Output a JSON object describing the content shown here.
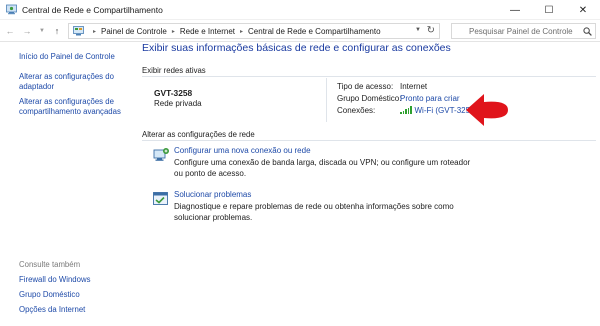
{
  "window": {
    "title": "Central de Rede e Compartilhamento",
    "controls": {
      "minimize": "—",
      "maximize": "☐",
      "close": "✕"
    }
  },
  "address_bar": {
    "breadcrumbs": [
      "Painel de Controle",
      "Rede e Internet",
      "Central de Rede e Compartilhamento"
    ],
    "search_placeholder": "Pesquisar Painel de Controle"
  },
  "sidebar": {
    "links": [
      "Início do Painel de Controle",
      "Alterar as configurações do adaptador",
      "Alterar as configurações de compartilhamento avançadas"
    ],
    "see_also_heading": "Consulte também",
    "see_also_links": [
      "Firewall do Windows",
      "Grupo Doméstico",
      "Opções da Internet"
    ]
  },
  "main": {
    "title": "Exibir suas informações básicas de rede e configurar as conexões",
    "active_networks_heading": "Exibir redes ativas",
    "network": {
      "name": "GVT-3258",
      "category": "Rede privada",
      "properties": [
        {
          "label": "Tipo de acesso:",
          "value": "Internet"
        },
        {
          "label": "Grupo Doméstico:",
          "value": "Pronto para criar"
        },
        {
          "label": "Conexões:",
          "value": "Wi-Fi (GVT-3258)"
        }
      ]
    },
    "change_settings_heading": "Alterar as configurações de rede",
    "tasks": [
      {
        "icon": "network-setup-icon",
        "title": "Configurar uma nova conexão ou rede",
        "description": "Configure uma conexão de banda larga, discada ou VPN; ou configure um roteador ou ponto de acesso."
      },
      {
        "icon": "troubleshoot-icon",
        "title": "Solucionar problemas",
        "description": "Diagnostique e repare problemas de rede ou obtenha informações sobre como solucionar problemas."
      }
    ]
  },
  "colors": {
    "link": "#1e4aa8",
    "title": "#1a3aa0",
    "annotation_arrow": "#e0141b",
    "wifi_signal": "#2da02d"
  }
}
